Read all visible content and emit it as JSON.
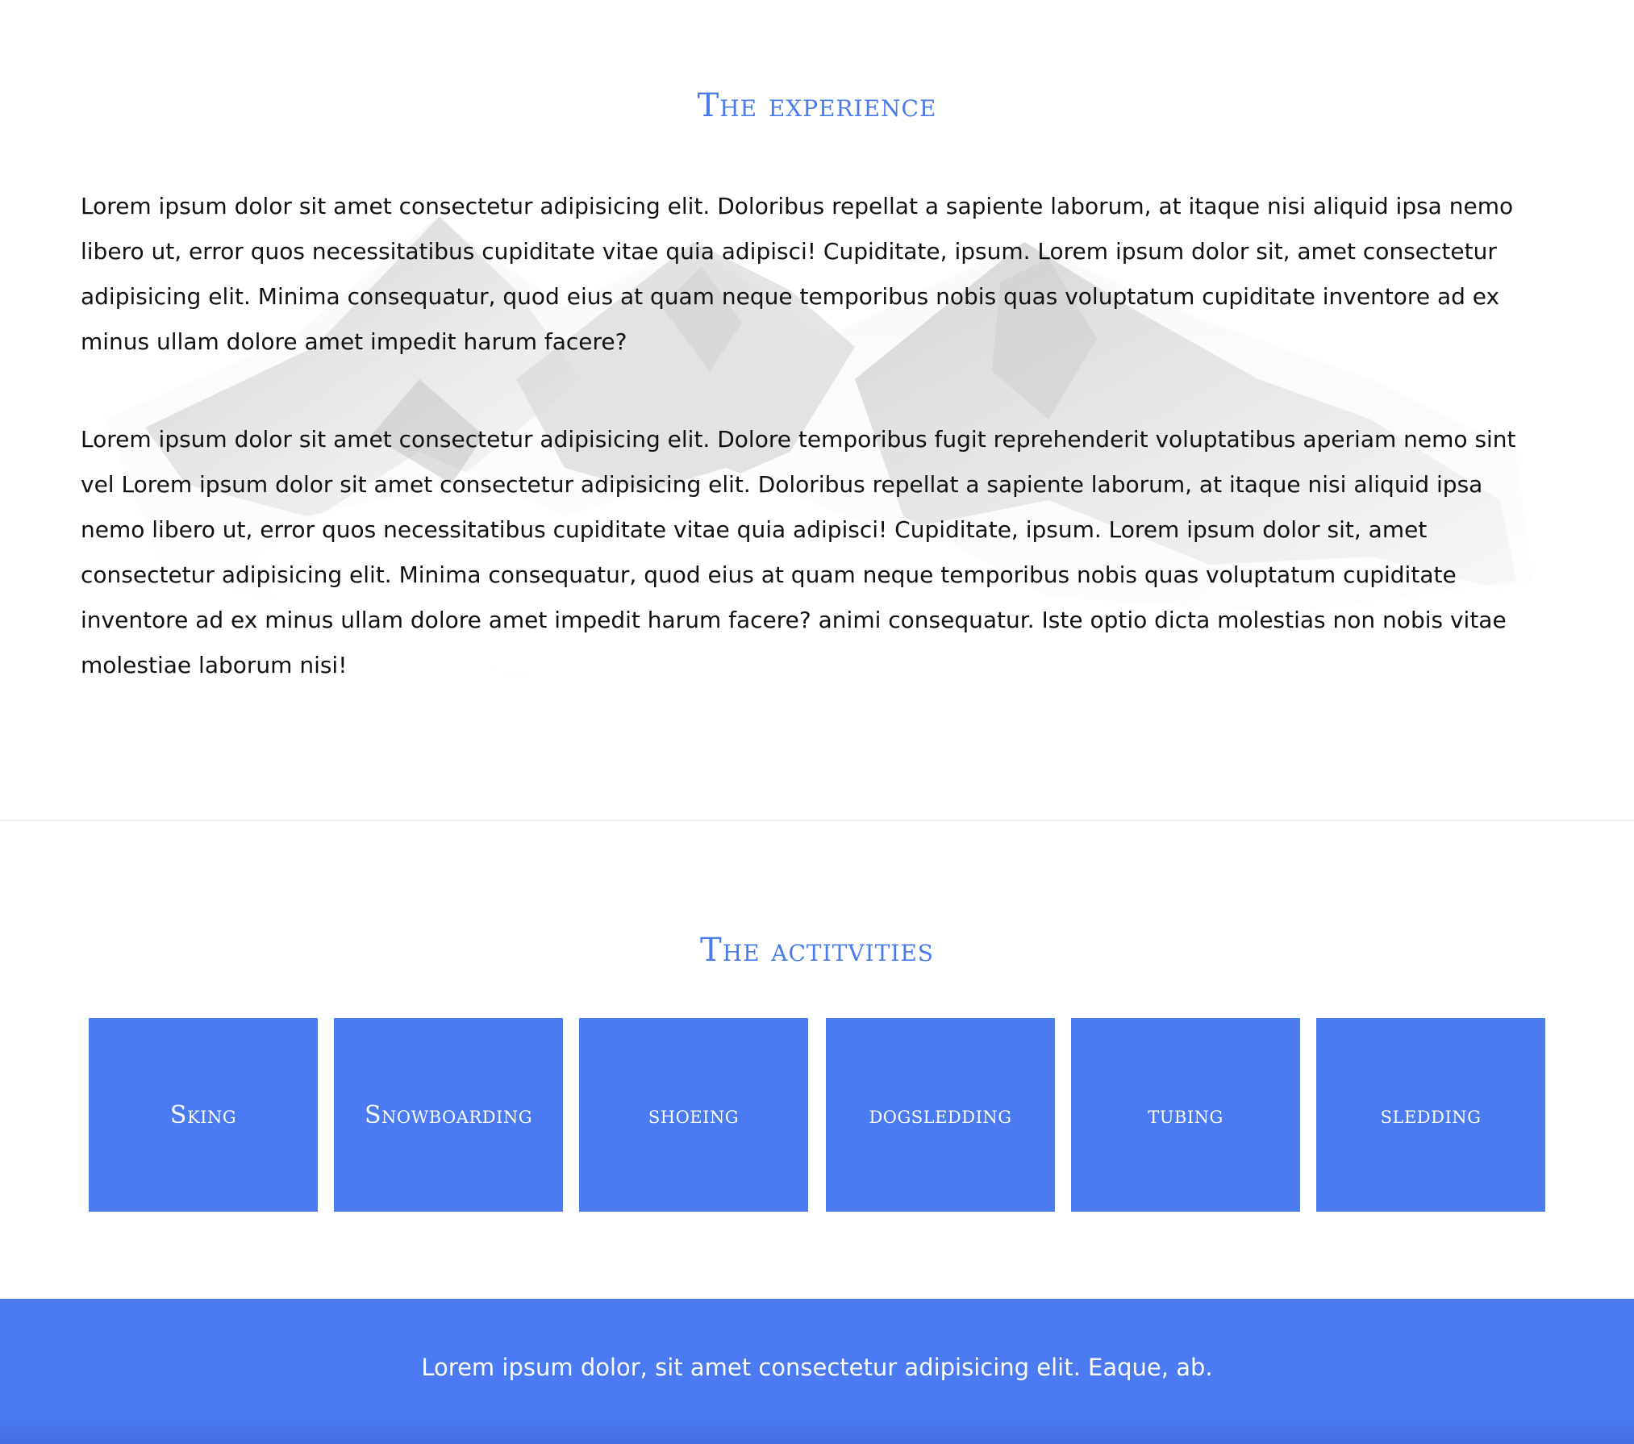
{
  "experience": {
    "title": "The experience",
    "paragraphs": [
      "Lorem ipsum dolor sit amet consectetur adipisicing elit. Doloribus repellat a sapiente laborum, at itaque nisi aliquid ipsa nemo libero ut, error quos necessitatibus cupiditate vitae quia adipisci! Cupiditate, ipsum. Lorem ipsum dolor sit, amet consectetur adipisicing elit. Minima consequatur, quod eius at quam neque temporibus nobis quas voluptatum cupiditate inventore ad ex minus ullam dolore amet impedit harum facere?",
      "Lorem ipsum dolor sit amet consectetur adipisicing elit. Dolore temporibus fugit reprehenderit voluptatibus aperiam nemo sint vel Lorem ipsum dolor sit amet consectetur adipisicing elit. Doloribus repellat a sapiente laborum, at itaque nisi aliquid ipsa nemo libero ut, error quos necessitatibus cupiditate vitae quia adipisci! Cupiditate, ipsum. Lorem ipsum dolor sit, amet consectetur adipisicing elit. Minima consequatur, quod eius at quam neque temporibus nobis quas voluptatum cupiditate inventore ad ex minus ullam dolore amet impedit harum facere? animi consequatur. Iste optio dicta molestias non nobis vitae molestiae laborum nisi!"
    ]
  },
  "activities": {
    "title": "The actitvities",
    "items": [
      {
        "label": "Sking"
      },
      {
        "label": "Snowboarding"
      },
      {
        "label": "shoeing"
      },
      {
        "label": "dogsledding"
      },
      {
        "label": "tubing"
      },
      {
        "label": "sledding"
      }
    ]
  },
  "footer": {
    "text": "Lorem ipsum dolor, sit amet consectetur adipisicing elit. Eaque, ab."
  },
  "colors": {
    "accent": "#4a7bf3",
    "heading": "#4a7bec",
    "text": "#111111",
    "background": "#ffffff"
  }
}
